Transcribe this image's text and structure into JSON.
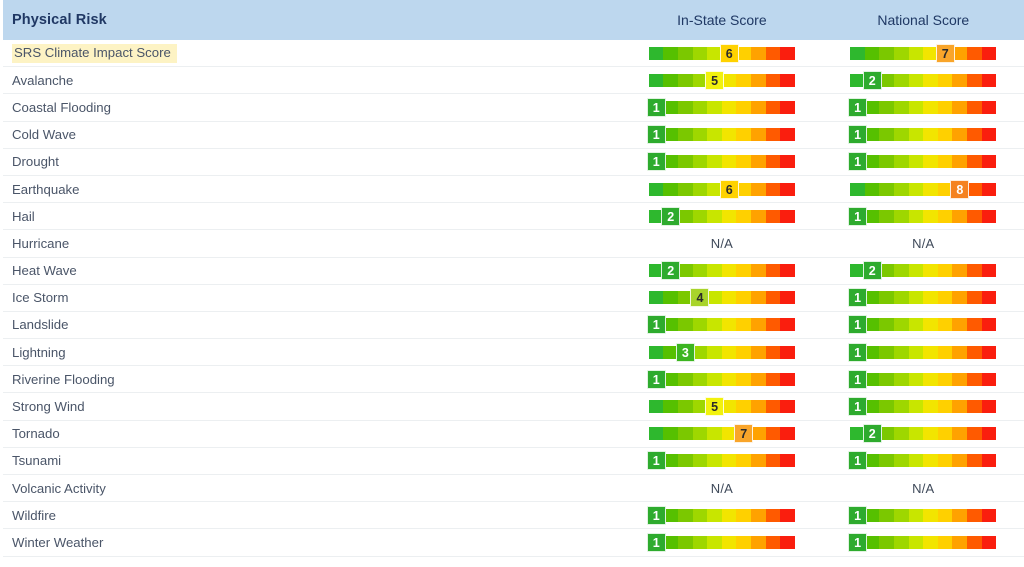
{
  "header": {
    "risk_label": "Physical Risk",
    "in_state_label": "In-State Score",
    "national_label": "National Score",
    "bg_color": "#bdd7ee",
    "text_color": "#1f3864"
  },
  "na_text": "N/A",
  "palette": {
    "scale": [
      "#2eb82e",
      "#56c000",
      "#7bc800",
      "#9ed700",
      "#c8e600",
      "#f2e500",
      "#ffd000",
      "#ffa200",
      "#ff5a00",
      "#fa1e0e"
    ],
    "badge_bg": [
      "#2eab2e",
      "#2eab2e",
      "#3cb521",
      "#a8d42a",
      "#f2f20d",
      "#ffd200",
      "#f9a52a",
      "#f58220",
      "#f25c1e",
      "#e8311b"
    ],
    "badge_fg": [
      "#ffffff",
      "#ffffff",
      "#ffffff",
      "#2b2b2b",
      "#2b2b2b",
      "#2b2b2b",
      "#2b2b2b",
      "#ffffff",
      "#ffffff",
      "#ffffff"
    ],
    "highlight": "#fdf3c4",
    "row_border": "#eceff1",
    "label_color": "#4a5568"
  },
  "rows": [
    {
      "name": "SRS Climate Impact Score",
      "highlight": true,
      "in_state": 6,
      "national": 7
    },
    {
      "name": "Avalanche",
      "highlight": false,
      "in_state": 5,
      "national": 2
    },
    {
      "name": "Coastal Flooding",
      "highlight": false,
      "in_state": 1,
      "national": 1
    },
    {
      "name": "Cold Wave",
      "highlight": false,
      "in_state": 1,
      "national": 1
    },
    {
      "name": "Drought",
      "highlight": false,
      "in_state": 1,
      "national": 1
    },
    {
      "name": "Earthquake",
      "highlight": false,
      "in_state": 6,
      "national": 8
    },
    {
      "name": "Hail",
      "highlight": false,
      "in_state": 2,
      "national": 1
    },
    {
      "name": "Hurricane",
      "highlight": false,
      "in_state": null,
      "national": null
    },
    {
      "name": "Heat Wave",
      "highlight": false,
      "in_state": 2,
      "national": 2
    },
    {
      "name": "Ice Storm",
      "highlight": false,
      "in_state": 4,
      "national": 1
    },
    {
      "name": "Landslide",
      "highlight": false,
      "in_state": 1,
      "national": 1
    },
    {
      "name": "Lightning",
      "highlight": false,
      "in_state": 3,
      "national": 1
    },
    {
      "name": "Riverine Flooding",
      "highlight": false,
      "in_state": 1,
      "national": 1
    },
    {
      "name": "Strong Wind",
      "highlight": false,
      "in_state": 5,
      "national": 1
    },
    {
      "name": "Tornado",
      "highlight": false,
      "in_state": 7,
      "national": 2
    },
    {
      "name": "Tsunami",
      "highlight": false,
      "in_state": 1,
      "national": 1
    },
    {
      "name": "Volcanic Activity",
      "highlight": false,
      "in_state": null,
      "national": null
    },
    {
      "name": "Wildfire",
      "highlight": false,
      "in_state": 1,
      "national": 1
    },
    {
      "name": "Winter Weather",
      "highlight": false,
      "in_state": 1,
      "national": 1
    }
  ],
  "chart_data": {
    "type": "table",
    "title": "Physical Risk",
    "columns": [
      "Physical Risk",
      "In-State Score",
      "National Score"
    ],
    "scale_min": 1,
    "scale_max": 10,
    "categories": [
      "SRS Climate Impact Score",
      "Avalanche",
      "Coastal Flooding",
      "Cold Wave",
      "Drought",
      "Earthquake",
      "Hail",
      "Hurricane",
      "Heat Wave",
      "Ice Storm",
      "Landslide",
      "Lightning",
      "Riverine Flooding",
      "Strong Wind",
      "Tornado",
      "Tsunami",
      "Volcanic Activity",
      "Wildfire",
      "Winter Weather"
    ],
    "series": [
      {
        "name": "In-State Score",
        "values": [
          6,
          5,
          1,
          1,
          1,
          6,
          2,
          null,
          2,
          4,
          1,
          3,
          1,
          5,
          7,
          1,
          null,
          1,
          1
        ]
      },
      {
        "name": "National Score",
        "values": [
          7,
          2,
          1,
          1,
          1,
          8,
          1,
          null,
          2,
          1,
          1,
          1,
          1,
          1,
          2,
          1,
          null,
          1,
          1
        ]
      }
    ]
  }
}
